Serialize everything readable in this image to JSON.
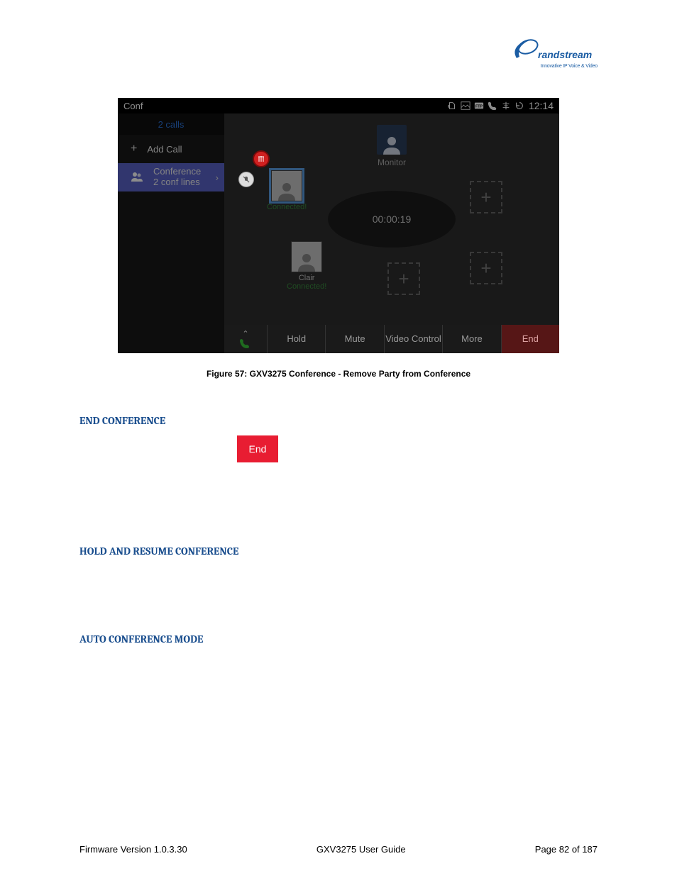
{
  "logo": {
    "brand": "Grandstream",
    "tagline": "Innovative IP Voice & Video"
  },
  "screenshot": {
    "statusbar": {
      "title": "Conf",
      "time": "12:14"
    },
    "side": {
      "calls_header": "2 calls",
      "add_call": "Add Call",
      "conference_line1": "Conference",
      "conference_line2": "2 conf lines"
    },
    "main": {
      "monitor_label": "Monitor",
      "duration": "00:00:19",
      "participant_highlight": {
        "name": "",
        "status": "Connected!"
      },
      "participant_clair": {
        "name": "Clair",
        "status": "Connected!"
      }
    },
    "bottombar": {
      "hold": "Hold",
      "mute": "Mute",
      "video_control": "Video Control",
      "more": "More",
      "end": "End"
    }
  },
  "caption": "Figure 57: GXV3275 Conference - Remove Party from Conference",
  "headings": {
    "end_conference": "END CONFERENCE",
    "hold_resume": "HOLD AND RESUME CONFERENCE",
    "auto_conf": "AUTO CONFERENCE MODE"
  },
  "end_button_label": "End",
  "footer": {
    "left": "Firmware Version 1.0.3.30",
    "center": "GXV3275 User Guide",
    "right": "Page 82 of 187"
  }
}
